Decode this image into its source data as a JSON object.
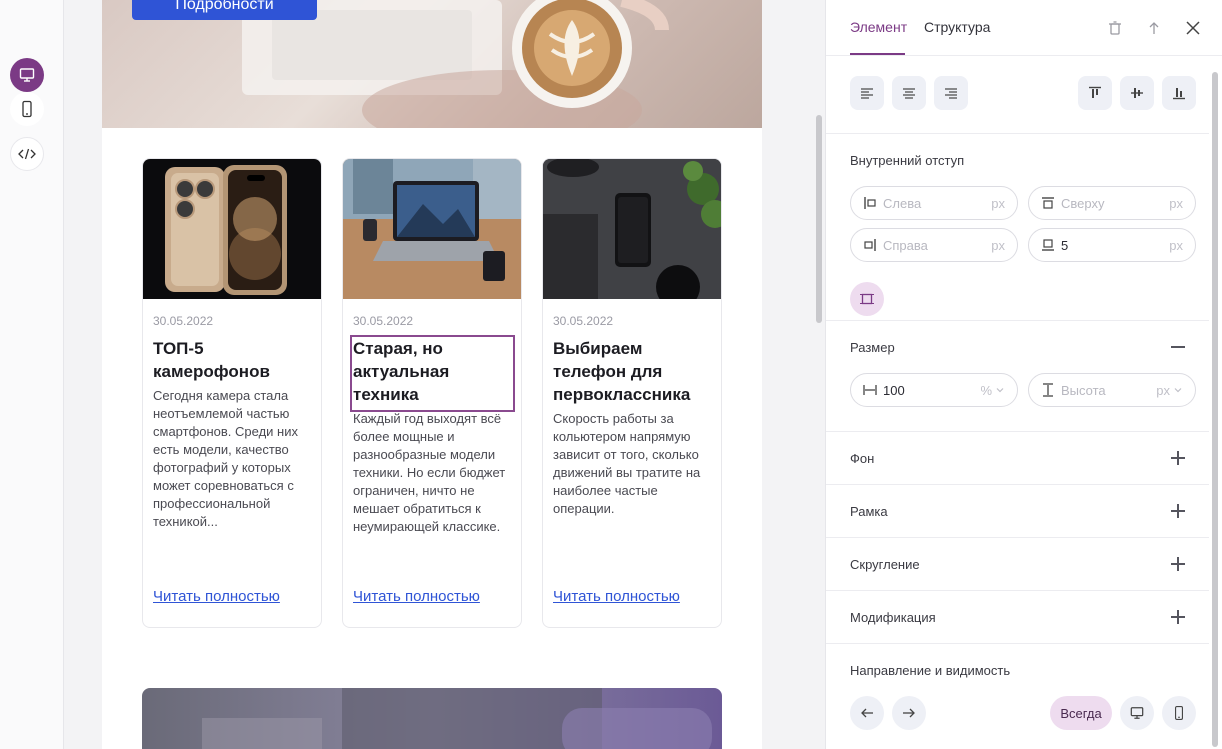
{
  "sidebar": {
    "tools": [
      {
        "icon": "desktop-icon"
      },
      {
        "icon": "mobile-icon"
      },
      {
        "icon": "code-icon"
      }
    ]
  },
  "canvas": {
    "hero_button": "Подробности",
    "cards": [
      {
        "date": "30.05.2022",
        "title": "ТОП-5 камерофонов",
        "text": "Сегодня камера стала неотъемлемой частью смартфонов. Среди них есть модели, качество фотографий у которых может соревноваться с профессиональной техникой...",
        "link": "Читать полностью"
      },
      {
        "date": "30.05.2022",
        "title": "Старая, но актуальная техника",
        "text": "Каждый год выходят всё более мощные и разнообразные модели техники. Но если бюджет ограничен, ничто не мешает обратиться к неумирающей классике.",
        "link": "Читать полностью"
      },
      {
        "date": "30.05.2022",
        "title": "Выбираем телефон для первоклассника",
        "text": "Скорость работы за кольютером напрямую зависит от того, сколько движений вы тратите на наиболее частые операции.",
        "link": "Читать полностью"
      }
    ]
  },
  "panel": {
    "tabs": [
      "Элемент",
      "Структура"
    ],
    "padding": {
      "title": "Внутренний отступ",
      "left_placeholder": "Слева",
      "top_placeholder": "Сверху",
      "right_placeholder": "Справа",
      "bottom_value": "5",
      "unit": "px"
    },
    "size": {
      "title": "Размер",
      "width_value": "100",
      "width_unit": "%",
      "height_placeholder": "Высота",
      "height_unit": "px"
    },
    "sections": [
      "Фон",
      "Рамка",
      "Скругление",
      "Модификация"
    ],
    "visibility": {
      "title": "Направление и видимость",
      "always_label": "Всегда"
    }
  },
  "colors": {
    "accent": "#7b3a85",
    "link": "#2f54d6"
  }
}
